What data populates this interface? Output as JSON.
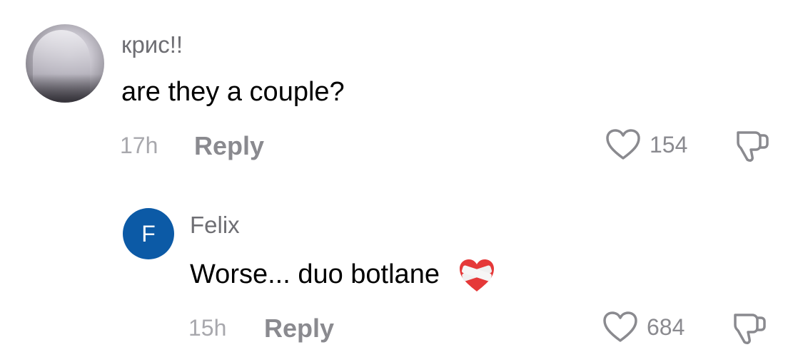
{
  "comments": [
    {
      "username": "крис!!",
      "text": "are they a couple?",
      "time": "17h",
      "reply_label": "Reply",
      "likes": "154"
    }
  ],
  "reply": {
    "avatar_letter": "F",
    "username": "Felix",
    "text": "Worse... duo botlane",
    "emoji_icon": "mending-heart-icon",
    "time": "15h",
    "reply_label": "Reply",
    "likes": "684"
  },
  "colors": {
    "avatar_bg": "#0c5aa6",
    "muted_text": "#8a8a8f"
  }
}
